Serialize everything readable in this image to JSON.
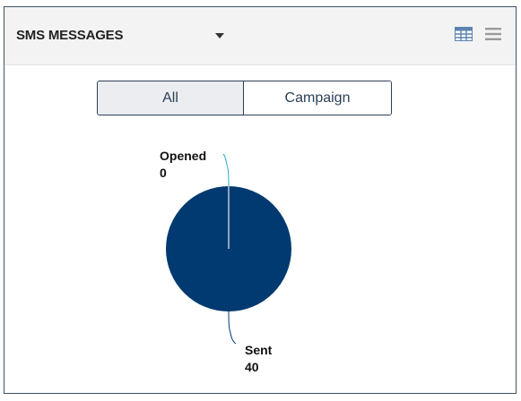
{
  "widget": {
    "title": "SMS MESSAGES"
  },
  "icons": {
    "dropdown": "chevron-down-icon",
    "table_view": "table-icon",
    "menu": "hamburger-menu-icon"
  },
  "segmented_control": {
    "options": [
      "All",
      "Campaign"
    ],
    "selected": "All"
  },
  "colors": {
    "pie_fill": "#003a70",
    "leader_opened": "#2aa6c9",
    "leader_sent": "#003a70",
    "icon_table": "#5b84b1",
    "icon_menu": "#9a9a9a"
  },
  "chart_data": {
    "type": "pie",
    "slices": [
      {
        "label": "Opened",
        "value": 0
      },
      {
        "label": "Sent",
        "value": 40
      }
    ]
  }
}
